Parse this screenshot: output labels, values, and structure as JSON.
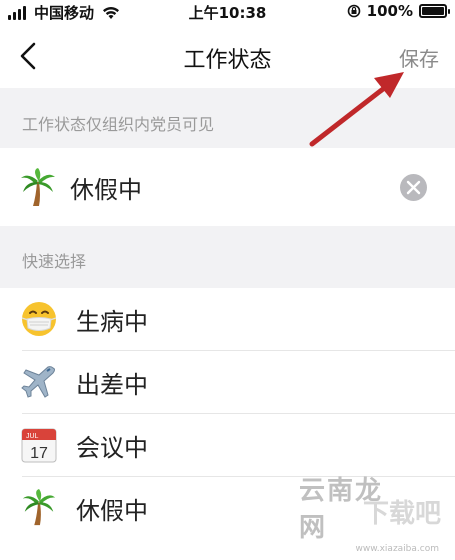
{
  "status_bar": {
    "carrier": "中国移动",
    "time": "上午10:38",
    "battery": "100%"
  },
  "nav": {
    "title": "工作状态",
    "save_label": "保存",
    "back_icon": "chevron-left-icon"
  },
  "notice": "工作状态仅组织内党员可见",
  "current_status": {
    "label": "休假中",
    "icon": "palm-tree-icon"
  },
  "quick_select": {
    "header": "快速选择",
    "items": [
      {
        "label": "生病中",
        "icon": "mask-face-icon"
      },
      {
        "label": "出差中",
        "icon": "airplane-icon"
      },
      {
        "label": "会议中",
        "icon": "calendar-icon"
      },
      {
        "label": "休假中",
        "icon": "palm-tree-icon"
      }
    ]
  },
  "calendar_icon": {
    "month": "JUL",
    "day": "17"
  },
  "watermark": {
    "main": "云南龙网",
    "sub": "下载吧",
    "url": "www.xiazaiba.com"
  },
  "colors": {
    "annotation_arrow": "#c0282a",
    "save_text": "#8a8a8a",
    "section_text": "#9a9a9a"
  }
}
